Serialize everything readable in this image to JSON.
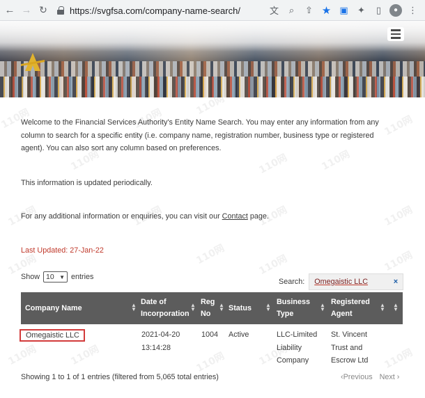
{
  "browser": {
    "back_icon": "←",
    "forward_icon": "→",
    "reload_icon": "C",
    "url": "https://svgfsa.com/company-name-search/"
  },
  "content": {
    "intro": "Welcome to the Financial Services Authority's Entity Name Search. You may enter any information from any column to search for a specific entity (i.e. company name, registration number, business type or registered agent). You can also sort any column based on preferences.",
    "periodic": "This information is updated periodically.",
    "contact_prefix": "For any additional information or enquiries, you can visit our ",
    "contact_link": "Contact",
    "contact_suffix": " page.",
    "last_updated": "Last Updated:  27-Jan-22"
  },
  "controls": {
    "show_label": "Show",
    "entries_value": "10",
    "entries_label": "entries",
    "search_label": "Search:",
    "search_value": "Omegaistic LLC",
    "clear": "×"
  },
  "table": {
    "headers": [
      "Company Name",
      "Date of Incorporation",
      "Reg No",
      "Status",
      "Business Type",
      "Registered Agent"
    ],
    "row": {
      "company": "Omegaistic LLC",
      "date_line1": "2021-04-20",
      "date_line2": "13:14:28",
      "reg_no": "1004",
      "status": "Active",
      "type_line1": "LLC-Limited",
      "type_line2": "Liability",
      "type_line3": "Company",
      "agent_line1": "St. Vincent",
      "agent_line2": "Trust and",
      "agent_line3": "Escrow Ltd"
    }
  },
  "footer": {
    "info": "Showing 1 to 1 of 1 entries (filtered from 5,065 total entries)",
    "previous": "‹Previous",
    "next": "Next ›"
  },
  "colors": {
    "accent_red": "#c0392b",
    "table_header": "#5c5c5c",
    "star_blue": "#1a73e8"
  },
  "watermark": "110网"
}
